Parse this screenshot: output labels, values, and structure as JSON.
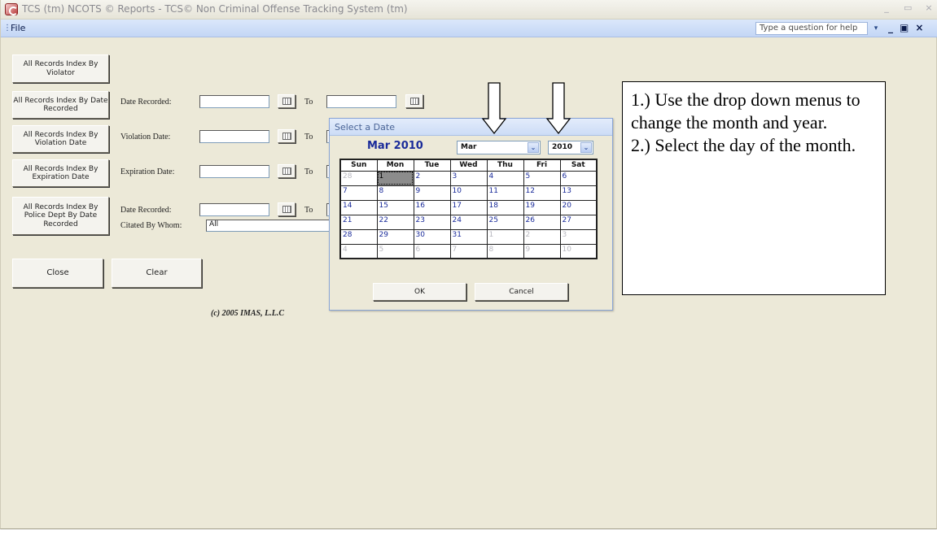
{
  "window": {
    "title": "TCS (tm) NCOTS © Reports - TCS© Non Criminal Offense Tracking System (tm)",
    "controls": [
      "_",
      "▭",
      "×"
    ]
  },
  "menubar": {
    "grip": "⋮",
    "file_label": "File",
    "help_placeholder": "Type a question for help",
    "help_dropdown": "▾",
    "mdi_controls": [
      "_",
      "▣",
      "×"
    ]
  },
  "buttons": {
    "by_violator": "All Records Index By Violator",
    "by_date_recorded": "All Records Index By Date Recorded",
    "by_violation_date": "All Records Index By Violation Date",
    "by_expiration_date": "All Records Index By Expiration Date",
    "by_police_dept": "All Records Index By Police Dept By Date Recorded",
    "close": "Close",
    "clear": "Clear"
  },
  "form": {
    "date_recorded_label": "Date Recorded:",
    "violation_date_label": "Violation Date:",
    "expiration_date_label": "Expiration Date:",
    "date_recorded2_label": "Date Recorded:",
    "citated_by_label": "Citated By Whom:",
    "citated_by_value": "All",
    "to_label": "To"
  },
  "copyright": "(c) 2005 IMAS, L.L.C",
  "date_picker": {
    "title": "Select a Date",
    "heading": "Mar 2010",
    "month_value": "Mar",
    "year_value": "2010",
    "dropdown_arrow": "⌄",
    "weekdays": [
      "Sun",
      "Mon",
      "Tue",
      "Wed",
      "Thu",
      "Fri",
      "Sat"
    ],
    "weeks": [
      [
        "28",
        "1",
        "2",
        "3",
        "4",
        "5",
        "6"
      ],
      [
        "7",
        "8",
        "9",
        "10",
        "11",
        "12",
        "13"
      ],
      [
        "14",
        "15",
        "16",
        "17",
        "18",
        "19",
        "20"
      ],
      [
        "21",
        "22",
        "23",
        "24",
        "25",
        "26",
        "27"
      ],
      [
        "28",
        "29",
        "30",
        "31",
        "1",
        "2",
        "3"
      ],
      [
        "4",
        "5",
        "6",
        "7",
        "8",
        "9",
        "10"
      ]
    ],
    "selected_day": "1",
    "ok_label": "OK",
    "cancel_label": "Cancel"
  },
  "annotation": {
    "step1": "1.) Use the drop down menus to change the month and year.",
    "step2": "2.) Select the day of the month."
  },
  "colors": {
    "window_bg": "#ece9d8",
    "menubar_bg": "#c3d6f5",
    "calendar_text": "#1a2b9a",
    "selected_day": "#8c8c8c"
  }
}
